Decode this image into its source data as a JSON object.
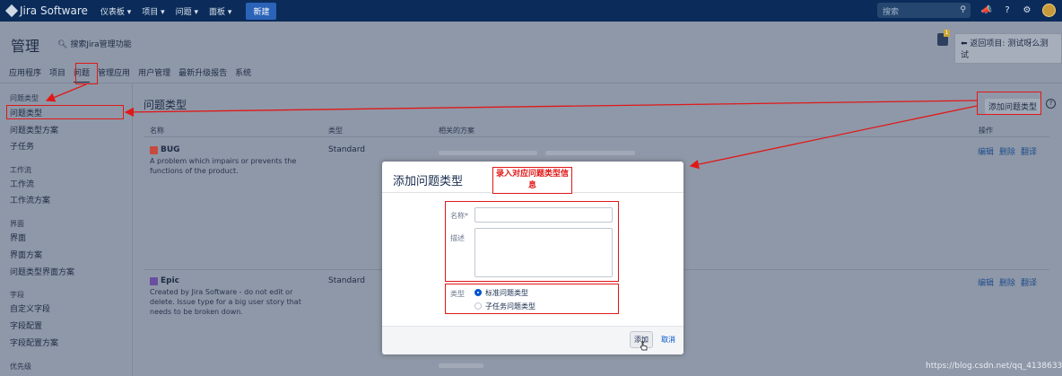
{
  "topnav": {
    "logo": "Jira Software",
    "items": [
      "仪表板 ▾",
      "项目 ▾",
      "问题 ▾",
      "面板 ▾"
    ],
    "create": "新建",
    "search_placeholder": "搜索"
  },
  "header": {
    "title": "管理",
    "search": "搜索Jira管理功能",
    "return_button": "返回项目: 测试呀么测试",
    "notif_count": "1"
  },
  "tabs": [
    "应用程序",
    "项目",
    "问题",
    "管理应用",
    "用户管理",
    "最新升级报告",
    "系统"
  ],
  "sidebar": {
    "groups": {
      "issue_types": "问题类型",
      "workflows": "工作流",
      "screens": "界面",
      "fields": "字段",
      "priorities": "优先级"
    },
    "items": {
      "issue_types": "问题类型",
      "issue_type_schemes": "问题类型方案",
      "subtasks": "子任务",
      "workflows": "工作流",
      "workflow_schemes": "工作流方案",
      "screens": "界面",
      "screen_schemes": "界面方案",
      "issue_type_screen_schemes": "问题类型界面方案",
      "custom_fields": "自定义字段",
      "field_configs": "字段配置",
      "field_config_schemes": "字段配置方案"
    }
  },
  "main": {
    "title": "问题类型",
    "add_button": "添加问题类型",
    "columns": [
      "名称",
      "类型",
      "相关的方案",
      "操作"
    ],
    "rows": [
      {
        "name": "BUG",
        "desc": "A problem which impairs or prevents the functions of the product.",
        "type": "Standard",
        "ops": [
          "编辑",
          "删除",
          "翻译"
        ],
        "icon_color": "#d04437"
      },
      {
        "name": "Epic",
        "desc": "Created by Jira Software - do not edit or delete. Issue type for a big user story that needs to be broken down.",
        "type": "Standard",
        "ops": [
          "编辑",
          "删除",
          "翻译"
        ],
        "icon_color": "#654982"
      }
    ]
  },
  "dialog": {
    "title": "添加问题类型",
    "name_label": "名称*",
    "desc_label": "描述",
    "type_label": "类型",
    "type_options": [
      {
        "label": "标准问题类型",
        "selected": true
      },
      {
        "label": "子任务问题类型",
        "selected": false
      }
    ],
    "add_button": "添加",
    "cancel_link": "取消"
  },
  "annotation": {
    "note": "录入对应问题类型信息",
    "color": "#e01818"
  },
  "watermark": "https://blog.csdn.net/qq_41386332"
}
